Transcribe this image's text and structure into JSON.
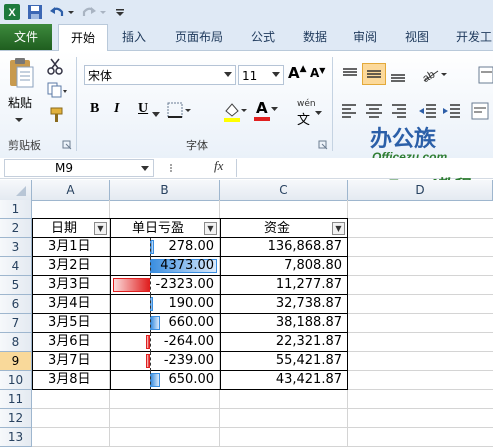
{
  "ribbon": {
    "tabs": [
      "文件",
      "开始",
      "插入",
      "页面布局",
      "公式",
      "数据",
      "审阅",
      "视图",
      "开发工"
    ],
    "clipboard": {
      "paste": "粘贴",
      "group_label": "剪贴板"
    },
    "font": {
      "name": "宋体",
      "size": "11",
      "bold": "B",
      "italic": "I",
      "underline": "U",
      "group_label": "字体",
      "grow": "A",
      "shrink": "A",
      "font_color": "A",
      "phonetic": "wén"
    }
  },
  "formula_bar": {
    "name_box": "M9",
    "fx": "fx",
    "value": ""
  },
  "watermark": {
    "line1": "办公族",
    "line2": "Officezu.com",
    "line3": "Excel教程"
  },
  "grid": {
    "columns": [
      "A",
      "B",
      "C",
      "D"
    ],
    "rows": [
      "1",
      "2",
      "3",
      "4",
      "5",
      "6",
      "7",
      "8",
      "9",
      "10",
      "11",
      "12",
      "13"
    ],
    "selected_row": "9",
    "headers": [
      "日期",
      "单日亏盈",
      "资金"
    ],
    "data": [
      {
        "date": "3月1日",
        "pl": "278.00",
        "fund": "136,868.87",
        "value": 278
      },
      {
        "date": "3月2日",
        "pl": "4373.00",
        "fund": "7,808.80",
        "value": 4373
      },
      {
        "date": "3月3日",
        "pl": "-2323.00",
        "fund": "11,277.87",
        "value": -2323
      },
      {
        "date": "3月4日",
        "pl": "190.00",
        "fund": "32,738.87",
        "value": 190
      },
      {
        "date": "3月5日",
        "pl": "660.00",
        "fund": "38,188.87",
        "value": 660
      },
      {
        "date": "3月6日",
        "pl": "-264.00",
        "fund": "22,321.87",
        "value": -264
      },
      {
        "date": "3月7日",
        "pl": "-239.00",
        "fund": "55,421.87",
        "value": -239
      },
      {
        "date": "3月8日",
        "pl": "650.00",
        "fund": "43,421.87",
        "value": 650
      }
    ],
    "positive_color": "#3a8ee0",
    "negative_color": "#e02020"
  }
}
